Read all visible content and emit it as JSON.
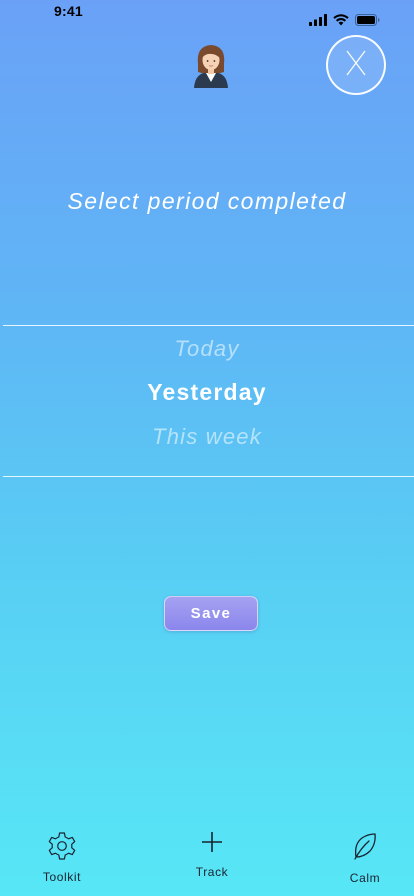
{
  "status_bar": {
    "time": "9:41",
    "icons": [
      "signal-icon",
      "wifi-icon",
      "battery-icon"
    ]
  },
  "header": {
    "avatar": "user-avatar-icon",
    "close_icon": "close-icon"
  },
  "main": {
    "title": "Select period completed",
    "picker": {
      "options": [
        "Today",
        "Yesterday",
        "This week"
      ],
      "selected": "Yesterday"
    },
    "save_label": "Save"
  },
  "bottom_nav": {
    "items": [
      {
        "label": "Toolkit",
        "icon": "gear-icon"
      },
      {
        "label": "Track",
        "icon": "plus-icon"
      },
      {
        "label": "Calm",
        "icon": "leaf-icon"
      }
    ]
  },
  "colors": {
    "gradient_top": "#6aa1f7",
    "gradient_bottom": "#57e7f6",
    "save_button": "#9a96f0",
    "nav_text": "#1a2230"
  }
}
